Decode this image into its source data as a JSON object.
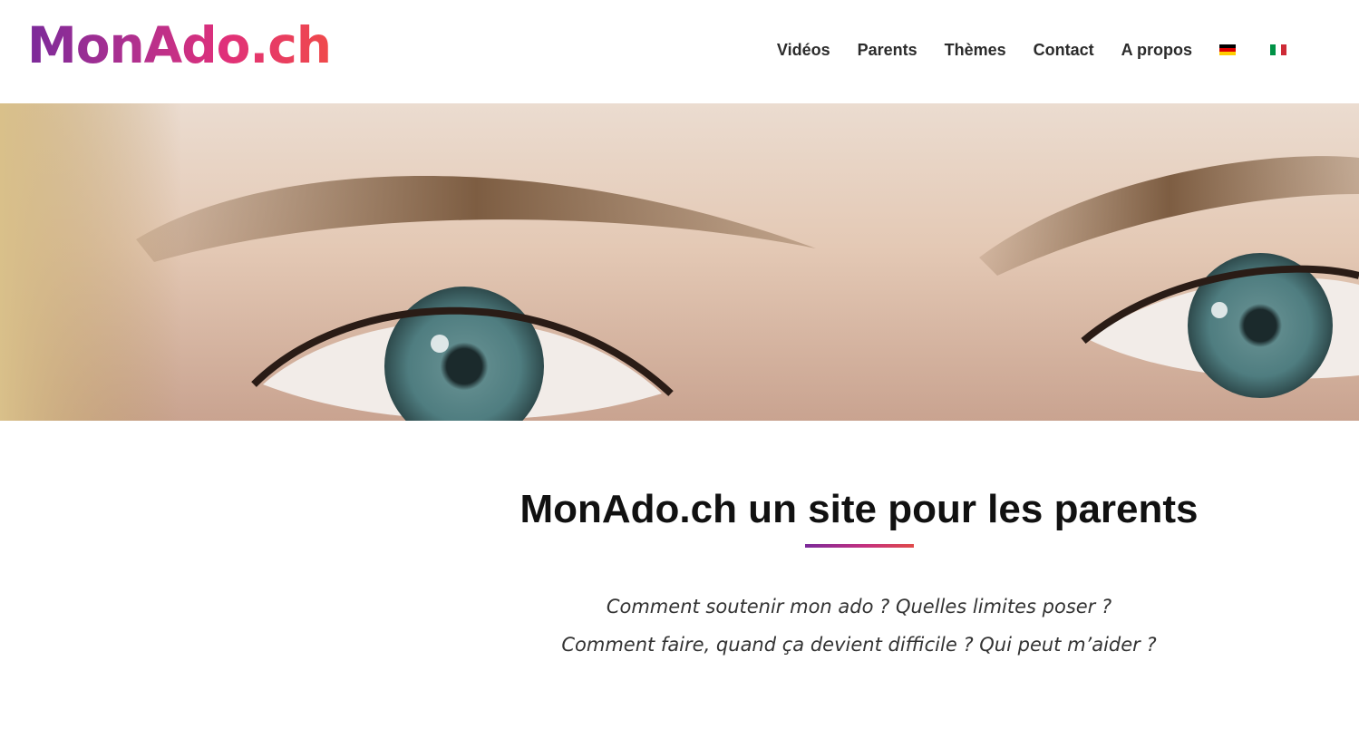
{
  "brand": {
    "logo_text": "MonAdo.ch",
    "gradient": [
      "#7b2a9a",
      "#e0307a",
      "#f04a4a"
    ]
  },
  "nav": {
    "items": [
      {
        "label": "Vidéos"
      },
      {
        "label": "Parents"
      },
      {
        "label": "Thèmes"
      },
      {
        "label": "Contact"
      },
      {
        "label": "A propos"
      }
    ],
    "languages": [
      {
        "flag": "german-flag-icon",
        "colors": [
          "#000000",
          "#dd0000",
          "#ffce00"
        ]
      },
      {
        "flag": "italian-flag-icon",
        "colors": [
          "#009246",
          "#ffffff",
          "#ce2b37"
        ]
      }
    ]
  },
  "hero": {
    "image": "close-up of teenager's eyes with blue-green irises"
  },
  "main": {
    "title": "MonAdo.ch un site pour les parents",
    "lead_lines": [
      "Comment soutenir mon ado ? Quelles limites poser ?",
      "Comment faire, quand ça devient difficile ? Qui peut m’aider ?"
    ]
  }
}
